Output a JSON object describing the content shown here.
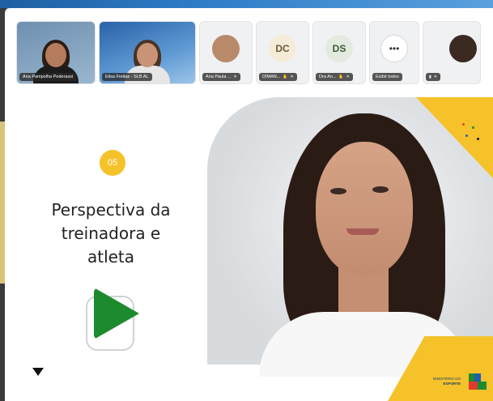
{
  "participants": [
    {
      "name": "Ana Pampolha Pederassi",
      "type": "video"
    },
    {
      "name": "Elisa Freitas - SLB AL",
      "type": "video2"
    },
    {
      "name": "Ana Paula ...",
      "type": "photo"
    },
    {
      "name": "DIMAN...",
      "type": "initials",
      "initials": "DC",
      "bg": "#f4ecd9",
      "fg": "#6b5a2e"
    },
    {
      "name": "Dra An...",
      "type": "initials",
      "initials": "DS",
      "bg": "#e3eadf",
      "fg": "#3b5a3a"
    },
    {
      "name": "Exibir todos",
      "type": "more",
      "icon": "more-dots-icon"
    },
    {
      "name": "",
      "type": "photo2"
    }
  ],
  "slide": {
    "number": "05",
    "title_lines": [
      "Perspectiva da",
      "treinadora e",
      "atleta"
    ],
    "ministry_line1": "MINISTÉRIO DO",
    "ministry_line2": "ESPORTE",
    "accent_yellow": "#f5c22a",
    "accent_green": "#1e8a2e"
  }
}
